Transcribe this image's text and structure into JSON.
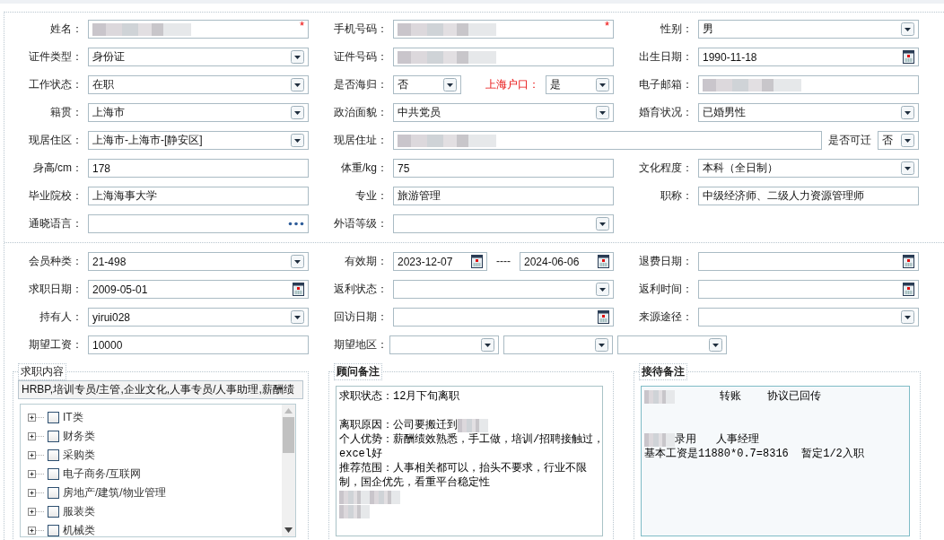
{
  "sections": [
    {
      "rows": [
        [
          {
            "label": "姓名：",
            "parts": [
              {
                "kind": "text",
                "redacted": true,
                "required_mark": "*"
              }
            ]
          },
          {
            "label": "手机号码：",
            "parts": [
              {
                "kind": "text",
                "redacted": true,
                "required_mark": "*"
              }
            ]
          },
          {
            "label": "性别：",
            "parts": [
              {
                "kind": "select",
                "value": "男"
              }
            ]
          }
        ],
        [
          {
            "label": "证件类型：",
            "parts": [
              {
                "kind": "select",
                "value": "身份证"
              }
            ]
          },
          {
            "label": "证件号码：",
            "parts": [
              {
                "kind": "text",
                "redacted": true
              }
            ]
          },
          {
            "label": "出生日期：",
            "parts": [
              {
                "kind": "date",
                "value": "1990-11-18"
              }
            ]
          }
        ],
        [
          {
            "label": "工作状态：",
            "parts": [
              {
                "kind": "select",
                "value": "在职"
              }
            ]
          },
          {
            "label": "是否海归：",
            "parts": [
              {
                "kind": "select",
                "value": "否"
              },
              {
                "kind": "label",
                "text": "上海户口：",
                "emphasis": true
              },
              {
                "kind": "select",
                "value": "是"
              }
            ]
          },
          {
            "label": "电子邮箱：",
            "parts": [
              {
                "kind": "text",
                "redacted": true
              }
            ]
          }
        ],
        [
          {
            "label": "籍贯：",
            "parts": [
              {
                "kind": "select",
                "value": "上海市"
              }
            ]
          },
          {
            "label": "政治面貌：",
            "parts": [
              {
                "kind": "select",
                "value": "中共党员"
              }
            ]
          },
          {
            "label": "婚育状况：",
            "parts": [
              {
                "kind": "select",
                "value": "已婚男性"
              }
            ]
          }
        ],
        [
          {
            "label": "现居住区：",
            "parts": [
              {
                "kind": "select",
                "value": " 上海市-上海市-[静安区]"
              }
            ]
          },
          {
            "label": "现居住址：",
            "wide": true,
            "parts": [
              {
                "kind": "text",
                "redacted": true
              },
              {
                "kind": "label",
                "text": "是否可迁",
                "emphasis": false
              },
              {
                "kind": "select",
                "value": "否"
              }
            ]
          }
        ],
        [
          {
            "label": "身高/cm：",
            "parts": [
              {
                "kind": "text",
                "value": "178"
              }
            ]
          },
          {
            "label": "体重/kg：",
            "parts": [
              {
                "kind": "text",
                "value": "75"
              }
            ]
          },
          {
            "label": "文化程度：",
            "parts": [
              {
                "kind": "select",
                "value": "本科（全日制）"
              }
            ]
          }
        ],
        [
          {
            "label": "毕业院校：",
            "parts": [
              {
                "kind": "text",
                "value": "上海海事大学"
              }
            ]
          },
          {
            "label": "专业：",
            "parts": [
              {
                "kind": "text",
                "value": "旅游管理"
              }
            ]
          },
          {
            "label": "职称：",
            "parts": [
              {
                "kind": "text",
                "value": "中级经济师、二级人力资源管理师"
              }
            ]
          }
        ],
        [
          {
            "label": "通晓语言：",
            "parts": [
              {
                "kind": "picker"
              }
            ]
          },
          {
            "label": "外语等级：",
            "parts": [
              {
                "kind": "select"
              }
            ]
          }
        ]
      ]
    },
    {
      "rows": [
        [
          {
            "label": "会员种类：",
            "parts": [
              {
                "kind": "select",
                "value": " 21-498"
              }
            ]
          },
          {
            "label": "有效期：",
            "parts": [
              {
                "kind": "date",
                "value": "2023-12-07"
              },
              {
                "kind": "separator",
                "text": "----"
              },
              {
                "kind": "date",
                "value": "2024-06-06"
              }
            ]
          },
          {
            "label": "退费日期：",
            "parts": [
              {
                "kind": "date"
              }
            ]
          }
        ],
        [
          {
            "label": "求职日期：",
            "parts": [
              {
                "kind": "date",
                "value": "2009-05-01"
              }
            ]
          },
          {
            "label": "返利状态：",
            "parts": [
              {
                "kind": "select"
              }
            ]
          },
          {
            "label": "返利时间：",
            "parts": [
              {
                "kind": "date"
              }
            ]
          }
        ],
        [
          {
            "label": "持有人：",
            "parts": [
              {
                "kind": "select",
                "value": "yirui028"
              }
            ]
          },
          {
            "label": "回访日期：",
            "parts": [
              {
                "kind": "date"
              }
            ]
          },
          {
            "label": "来源途径：",
            "parts": [
              {
                "kind": "select"
              }
            ]
          }
        ],
        [
          {
            "label": "期望工资：",
            "parts": [
              {
                "kind": "text",
                "value": "10000"
              }
            ]
          },
          {
            "label": "期望地区：",
            "wide": true,
            "parts": [
              {
                "kind": "select"
              },
              {
                "kind": "select"
              },
              {
                "kind": "select"
              }
            ]
          }
        ]
      ]
    }
  ],
  "job_interest": {
    "title": "求职内容",
    "summary": "HRBP,培训专员/主管,企业文化,人事专员/人事助理,薪酬绩",
    "tree": [
      {
        "label": "IT类",
        "expanded": false,
        "checked": false
      },
      {
        "label": "财务类",
        "expanded": false,
        "checked": false
      },
      {
        "label": "采购类",
        "expanded": false,
        "checked": false
      },
      {
        "label": "电子商务/互联网",
        "expanded": false,
        "checked": false
      },
      {
        "label": "房地产/建筑/物业管理",
        "expanded": false,
        "checked": false
      },
      {
        "label": "服装类",
        "expanded": false,
        "checked": false
      },
      {
        "label": "机械类",
        "expanded": false,
        "checked": false
      }
    ]
  },
  "notes": [
    {
      "title": "顾问备注",
      "tinted": false,
      "paragraphs": [
        [
          {
            "segments": [
              {
                "kind": "text",
                "text": "求职状态：12月下旬离职"
              }
            ]
          }
        ],
        [
          {
            "segments": [
              {
                "kind": "text",
                "text": "离职原因：公司要搬迁到"
              },
              {
                "kind": "redacted"
              }
            ]
          },
          {
            "segments": [
              {
                "kind": "text",
                "text": "个人优势：薪酬绩效熟悉，手工做，培训/招聘接触过，"
              }
            ]
          },
          {
            "segments": [
              {
                "kind": "text",
                "text": "excel好"
              }
            ]
          },
          {
            "segments": [
              {
                "kind": "text",
                "text": "推荐范围：人事相关都可以，抬头不要求，行业不限"
              }
            ]
          },
          {
            "segments": [
              {
                "kind": "text",
                "text": "制，国企优先，看重平台稳定性"
              }
            ]
          },
          {
            "segments": [
              {
                "kind": "redacted"
              },
              {
                "kind": "redacted"
              }
            ]
          },
          {
            "segments": [
              {
                "kind": "redacted"
              }
            ]
          }
        ]
      ]
    },
    {
      "title": "接待备注",
      "tinted": true,
      "paragraphs": [
        [
          {
            "segments": [
              {
                "kind": "redacted"
              },
              {
                "kind": "text",
                "text": "       转账    协议已回传"
              }
            ]
          }
        ],
        [
          {
            "segments": [
              {
                "kind": "redacted"
              },
              {
                "kind": "text",
                "text": "录用   人事经理"
              }
            ]
          },
          {
            "segments": [
              {
                "kind": "text",
                "text": "基本工资是11880*0.7=8316  暂定1/2入职"
              }
            ]
          }
        ]
      ]
    }
  ]
}
